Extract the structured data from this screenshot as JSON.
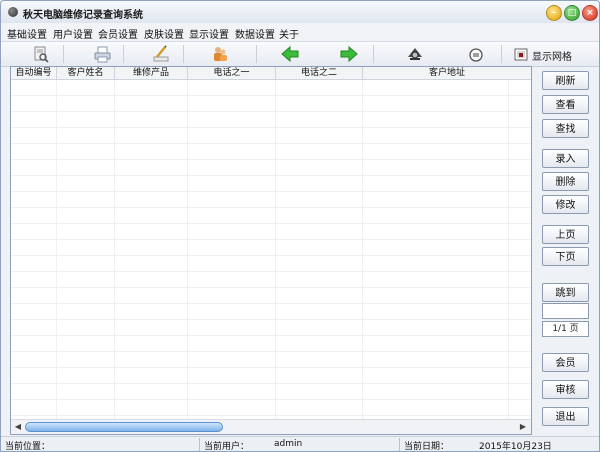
{
  "window": {
    "title": "秋天电脑维修记录查询系统"
  },
  "menu": {
    "items": [
      "基础设置",
      "用户设置",
      "会员设置",
      "皮肤设置",
      "显示设置",
      "数据设置",
      "关于"
    ]
  },
  "toolbar": {
    "icons": [
      "search-doc-icon",
      "print-icon",
      "edit-pen-icon",
      "users-icon",
      "arrow-left-icon",
      "arrow-right-icon",
      "camera-icon",
      "gauge-icon",
      "grid-toggle-icon"
    ],
    "grid_toggle_label": "显示网格"
  },
  "table": {
    "columns": [
      "自动编号",
      "客户姓名",
      "维修产品",
      "电话之一",
      "电话之二",
      "客户地址"
    ],
    "rows": []
  },
  "side_buttons": {
    "refresh": "刷新",
    "view": "查看",
    "find": "查找",
    "enter": "录入",
    "delete": "删除",
    "modify": "修改",
    "prev_page": "上页",
    "next_page": "下页",
    "jump": "跳到",
    "member": "会员",
    "audit": "审核",
    "exit": "退出"
  },
  "pagination": {
    "jump_value": "",
    "current": "1/1",
    "suffix": "页"
  },
  "status": {
    "location_label": "当前位置：",
    "user_label": "当前用户：",
    "user_value": "admin",
    "date_label": "当前日期：",
    "date_value": "2015年10月23日"
  },
  "colors": {
    "accent_green": "#29a829",
    "scroll_blue": "#7fb3ea"
  }
}
